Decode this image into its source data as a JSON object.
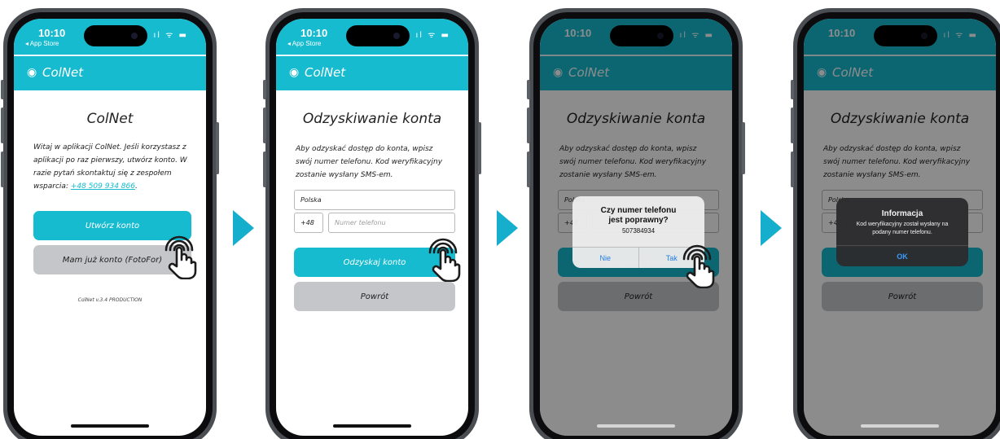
{
  "colors": {
    "accent": "#16bbd0",
    "secondary": "#c4c6c9",
    "arrow": "#16aecd",
    "alert_button": "#1f7ee6"
  },
  "statusbar": {
    "time": "10:10",
    "back_label": "◂ App Store",
    "icons": "ıl ᯤ ▬"
  },
  "appbar": {
    "brand": "ColNet",
    "logo_icon": "colnet-logo-icon"
  },
  "screen1": {
    "title": "ColNet",
    "intro": "Witaj w aplikacji ColNet. Jeśli korzystasz z aplikacji po raz pierwszy, utwórz konto. W razie pytań skontaktuj się z zespołem wsparcia: ",
    "phone_link": "+48 509 934 866",
    "intro_end": ".",
    "create_button": "Utwórz konto",
    "have_account_button": "Mam już konto (FotoFor)",
    "version": "ColNet v.3.4 PRODUCTION"
  },
  "recovery": {
    "title": "Odzyskiwanie konta",
    "description": "Aby odzyskać dostęp do konta, wpisz swój numer telefonu. Kod weryfikacyjny zostanie wysłany SMS-em.",
    "country": "Polska",
    "prefix": "+48",
    "phone_placeholder": "Numer telefonu",
    "recover_button": "Odzyskaj konto",
    "back_button": "Powrót"
  },
  "confirm_dialog": {
    "title_line1": "Czy numer telefonu",
    "title_line2": "jest poprawny?",
    "number": "507384934",
    "no_label": "Nie",
    "yes_label": "Tak"
  },
  "info_dialog": {
    "title": "Informacja",
    "message_line1": "Kod weryfikacyjny został wysłany na",
    "message_line2": "podany numer telefonu.",
    "ok_label": "OK"
  }
}
